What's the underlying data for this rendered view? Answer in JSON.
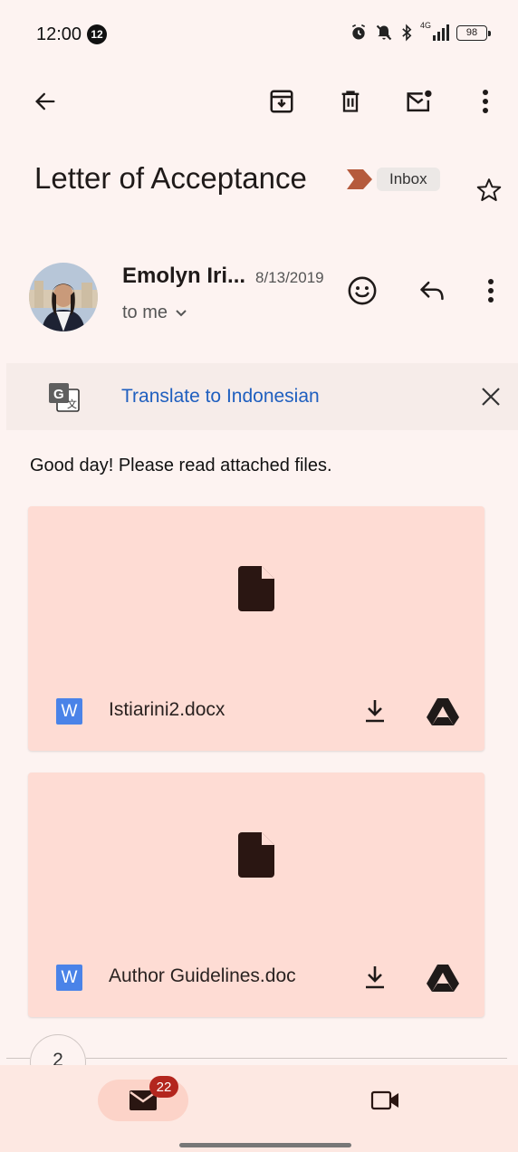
{
  "status_bar": {
    "time": "12:00",
    "notification_count": "12",
    "network": "4G",
    "battery": "98",
    "icons": [
      "alarm-icon",
      "mute-icon",
      "bluetooth-icon",
      "signal-icon"
    ]
  },
  "toolbar": {
    "icons": [
      "back-arrow-icon",
      "archive-icon",
      "delete-icon",
      "mark-unread-icon",
      "more-vert-icon"
    ]
  },
  "email": {
    "subject": "Letter of Acceptance",
    "label": "Inbox",
    "sender_name": "Emolyn Iri...",
    "date": "8/13/2019",
    "recipient": "to me",
    "body": "Good day! Please read attached files."
  },
  "translate": {
    "text": "Translate to Indonesian"
  },
  "attachments": [
    {
      "name": "Istiarini2.docx",
      "type_badge": "W"
    },
    {
      "name": "Author Guidelines.doc",
      "type_badge": "W"
    }
  ],
  "thread": {
    "count": "2"
  },
  "bottom_nav": {
    "mail_badge": "22"
  },
  "colors": {
    "background": "#fdf3f1",
    "attachment_bg": "#fedcd4",
    "link_blue": "#1f5fbf",
    "badge_red": "#b3261e",
    "word_blue": "#4a83e8"
  }
}
